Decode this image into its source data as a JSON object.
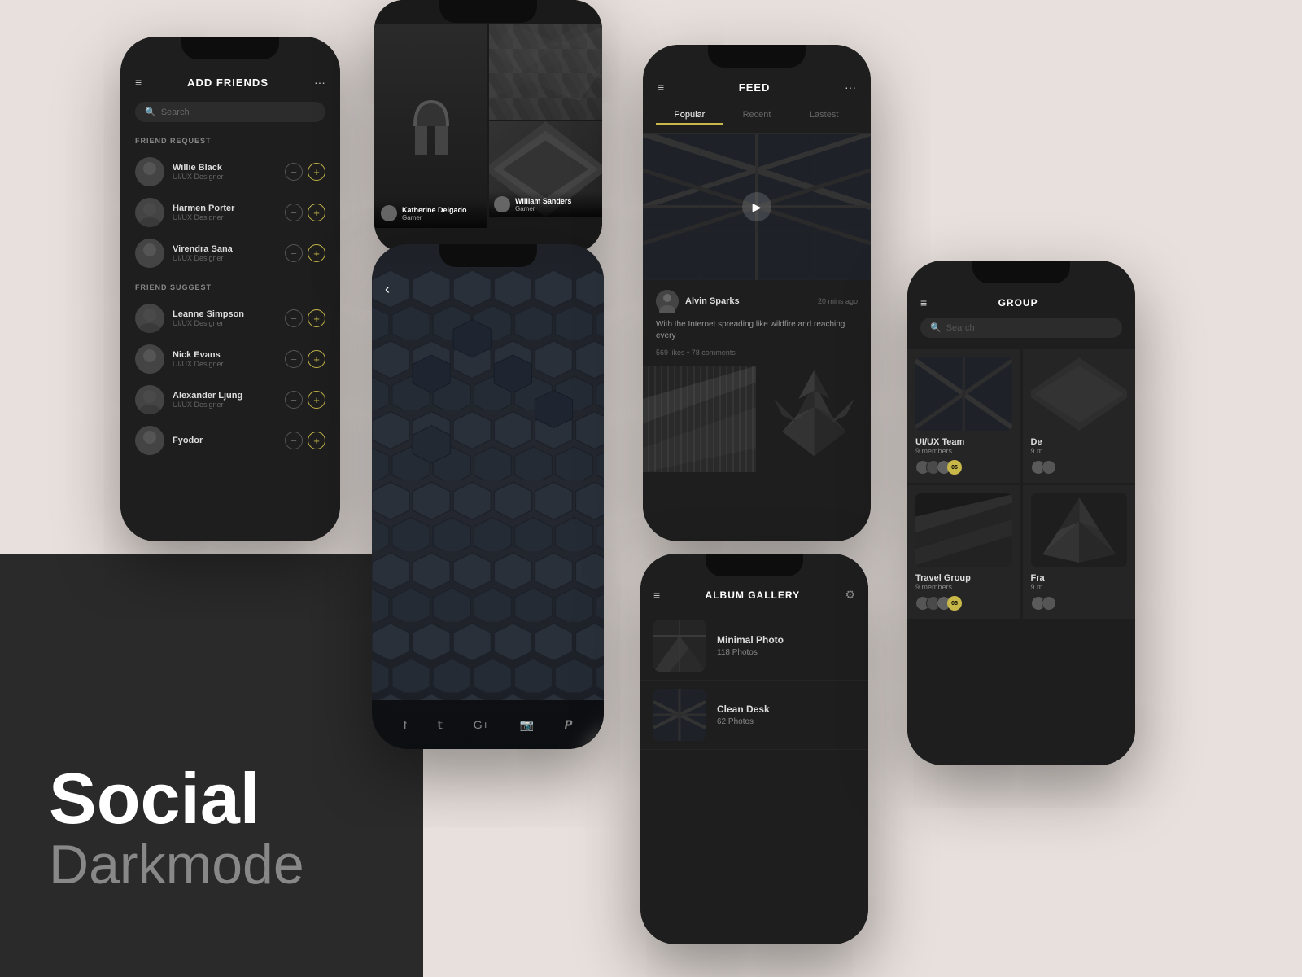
{
  "background": {
    "top_color": "#e8e0dc",
    "bottom_left_color": "#2a2a2a"
  },
  "brand": {
    "title": "Social",
    "subtitle": "Darkmode"
  },
  "phone_add_friends": {
    "header": {
      "title": "ADD FRIENDS",
      "menu_icon": "≡",
      "dots_icon": "···"
    },
    "search": {
      "placeholder": "Search",
      "icon": "🔍"
    },
    "friend_request_label": "FRIEND REQUEST",
    "friend_requests": [
      {
        "name": "Willie Black",
        "role": "UI/UX Designer"
      },
      {
        "name": "Harmen Porter",
        "role": "UI/UX Designer"
      },
      {
        "name": "Virendra Sana",
        "role": "UI/UX Designer"
      }
    ],
    "friend_suggest_label": "FRIEND SUGGEST",
    "friend_suggests": [
      {
        "name": "Leanne Simpson",
        "role": "UI/UX Designer"
      },
      {
        "name": "Nick Evans",
        "role": "UI/UX Designer"
      },
      {
        "name": "Alexander Ljung",
        "role": "UI/UX Designer"
      },
      {
        "name": "Fyodor",
        "role": ""
      }
    ]
  },
  "phone_profile": {
    "users": [
      {
        "name": "Katherine Delgado",
        "role": "Gamer"
      },
      {
        "name": "William Sanders",
        "role": "Gamer"
      }
    ]
  },
  "phone_hexagon": {
    "back_icon": "‹",
    "social_icons": [
      "f",
      "𝕥",
      "G+",
      "📷",
      "𝖕"
    ]
  },
  "phone_feed": {
    "header": {
      "title": "FEED",
      "dots_icon": "···",
      "menu_icon": "≡"
    },
    "tabs": [
      {
        "label": "Popular",
        "active": true
      },
      {
        "label": "Recent",
        "active": false
      },
      {
        "label": "Lastest",
        "active": false
      }
    ],
    "post": {
      "author": "Alvin Sparks",
      "time": "20 mins ago",
      "text": "With the Internet spreading like wildfire and reaching every",
      "likes": "569 likes",
      "comments": "78 comments"
    }
  },
  "phone_album": {
    "header": {
      "title": "ALBUM GALLERY",
      "gear_icon": "⚙"
    },
    "albums": [
      {
        "name": "Minimal Photo",
        "count": "118 Photos"
      },
      {
        "name": "Clean Desk",
        "count": "62 Photos"
      }
    ]
  },
  "phone_group": {
    "header": {
      "title": "GROUP",
      "menu_icon": "≡"
    },
    "search": {
      "placeholder": "Search"
    },
    "groups": [
      {
        "name": "UI/UX Team",
        "members": "9 members",
        "badge": "05"
      },
      {
        "name": "De",
        "members": "9 m",
        "badge": ""
      },
      {
        "name": "Travel Group",
        "members": "9 members",
        "badge": "05"
      },
      {
        "name": "Fra",
        "members": "9 m",
        "badge": ""
      }
    ]
  }
}
